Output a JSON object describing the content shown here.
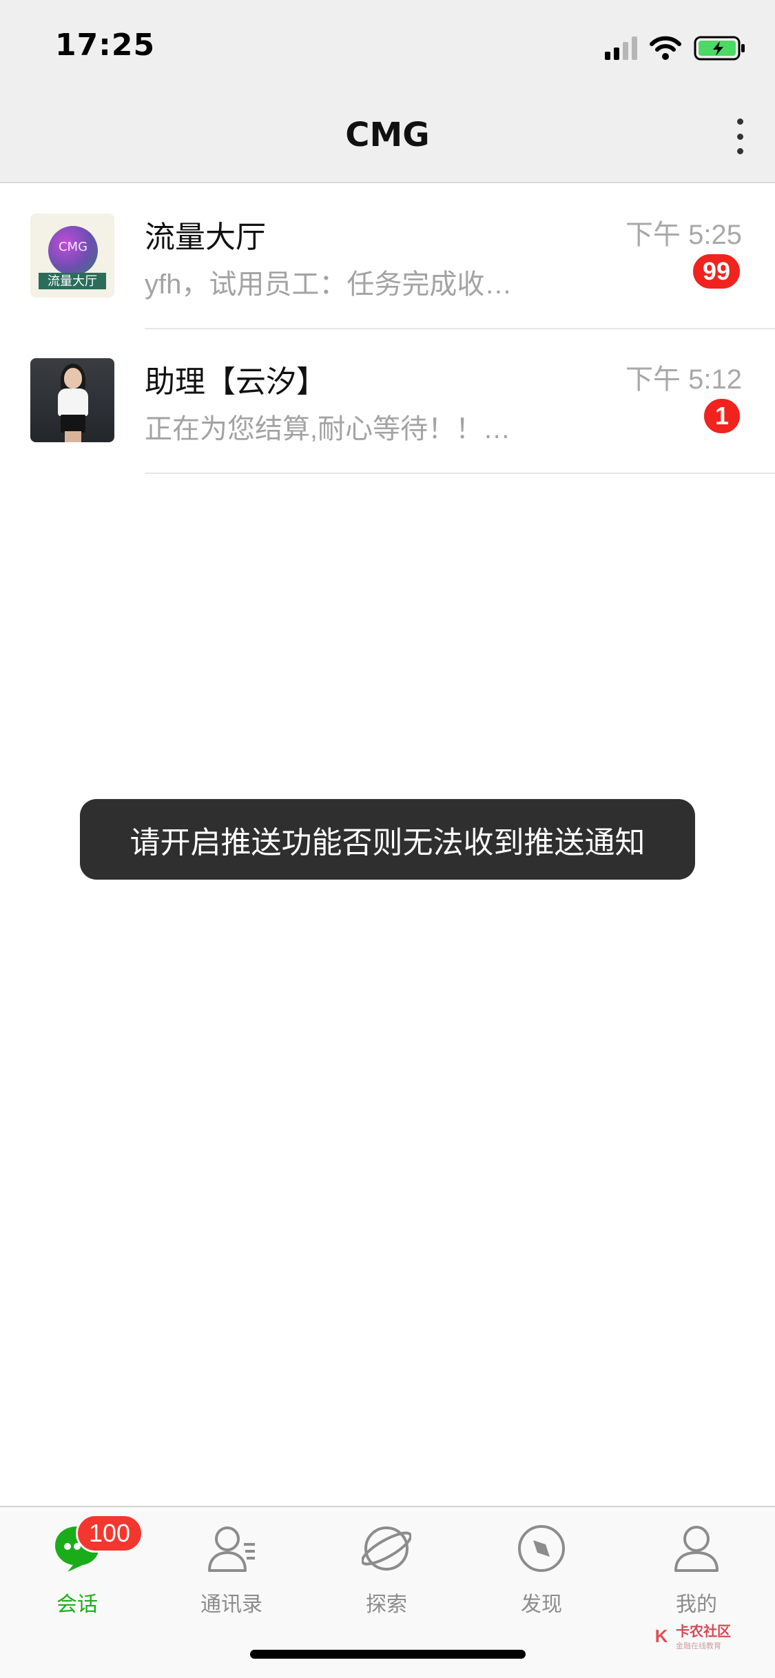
{
  "status_bar": {
    "time": "17:25"
  },
  "nav": {
    "title": "CMG"
  },
  "chats": [
    {
      "name": "流量大厅",
      "preview": "yfh，试用员工：任务完成收…",
      "time": "下午 5:25",
      "unread": "99",
      "avatar_caption": "流量大厅",
      "avatar_logo": "CMG"
    },
    {
      "name": "助理【云汐】",
      "preview": "正在为您结算,耐心等待！！…",
      "time": "下午 5:12",
      "unread": "1"
    }
  ],
  "toast": {
    "text": "请开启推送功能否则无法收到推送通知"
  },
  "tabbar": {
    "tabs": [
      {
        "label": "会话",
        "badge": "100",
        "icon": "chat-bubble-icon",
        "active": true
      },
      {
        "label": "通讯录",
        "icon": "contacts-icon"
      },
      {
        "label": "探索",
        "icon": "planet-icon"
      },
      {
        "label": "发现",
        "icon": "compass-icon"
      },
      {
        "label": "我的",
        "icon": "profile-icon"
      }
    ]
  },
  "watermark": {
    "title": "卡农社区",
    "subtitle": "金融在线教育"
  },
  "colors": {
    "accent": "#1aad19",
    "badge": "#f0231e",
    "toast_bg": "#2f2f2f"
  }
}
